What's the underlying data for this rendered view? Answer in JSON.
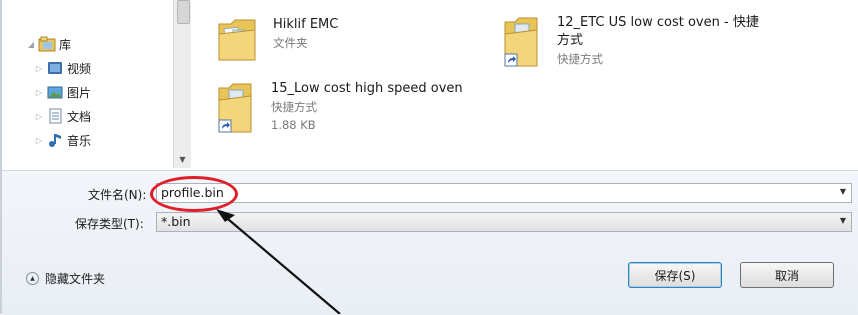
{
  "nav": {
    "items": [
      {
        "label": "库",
        "icon": "library-icon"
      },
      {
        "label": "视频",
        "icon": "video-icon"
      },
      {
        "label": "图片",
        "icon": "pictures-icon"
      },
      {
        "label": "文档",
        "icon": "documents-icon"
      },
      {
        "label": "音乐",
        "icon": "music-icon"
      }
    ]
  },
  "files": [
    {
      "name": "Hiklif EMC",
      "line2": "文件夹",
      "line3": "",
      "icon": "folder-icon"
    },
    {
      "name": "12_ETC US low cost oven - 快捷",
      "name2": "方式",
      "line2": "快捷方式",
      "icon": "folder-shortcut-icon"
    },
    {
      "name": "15_Low cost high speed oven",
      "line2": "快捷方式",
      "line3": "1.88 KB",
      "icon": "folder-shortcut-icon"
    }
  ],
  "form": {
    "filename_label": "文件名(N):",
    "filename_value": "profile.bin",
    "filetype_label": "保存类型(T):",
    "filetype_value": "*.bin"
  },
  "footer": {
    "hide_folders_label": "隐藏文件夹",
    "save_label": "保存(S)",
    "cancel_label": "取消"
  },
  "colors": {
    "annotation_red": "#e01e2a",
    "folder_yellow": "#f1d06a",
    "bottom_bg": "#ecf1f7"
  }
}
